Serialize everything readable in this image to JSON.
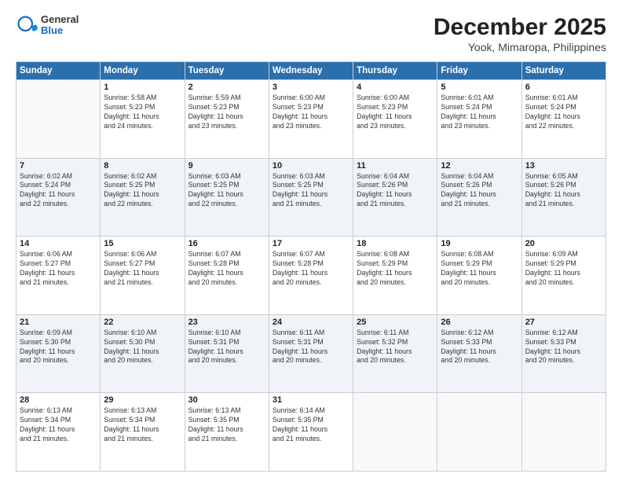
{
  "header": {
    "logo_general": "General",
    "logo_blue": "Blue",
    "month_title": "December 2025",
    "location": "Yook, Mimaropa, Philippines"
  },
  "days_of_week": [
    "Sunday",
    "Monday",
    "Tuesday",
    "Wednesday",
    "Thursday",
    "Friday",
    "Saturday"
  ],
  "weeks": [
    [
      {
        "day": "",
        "info": ""
      },
      {
        "day": "1",
        "info": "Sunrise: 5:58 AM\nSunset: 5:23 PM\nDaylight: 11 hours\nand 24 minutes."
      },
      {
        "day": "2",
        "info": "Sunrise: 5:59 AM\nSunset: 5:23 PM\nDaylight: 11 hours\nand 23 minutes."
      },
      {
        "day": "3",
        "info": "Sunrise: 6:00 AM\nSunset: 5:23 PM\nDaylight: 11 hours\nand 23 minutes."
      },
      {
        "day": "4",
        "info": "Sunrise: 6:00 AM\nSunset: 5:23 PM\nDaylight: 11 hours\nand 23 minutes."
      },
      {
        "day": "5",
        "info": "Sunrise: 6:01 AM\nSunset: 5:24 PM\nDaylight: 11 hours\nand 23 minutes."
      },
      {
        "day": "6",
        "info": "Sunrise: 6:01 AM\nSunset: 5:24 PM\nDaylight: 11 hours\nand 22 minutes."
      }
    ],
    [
      {
        "day": "7",
        "info": "Sunrise: 6:02 AM\nSunset: 5:24 PM\nDaylight: 11 hours\nand 22 minutes."
      },
      {
        "day": "8",
        "info": "Sunrise: 6:02 AM\nSunset: 5:25 PM\nDaylight: 11 hours\nand 22 minutes."
      },
      {
        "day": "9",
        "info": "Sunrise: 6:03 AM\nSunset: 5:25 PM\nDaylight: 11 hours\nand 22 minutes."
      },
      {
        "day": "10",
        "info": "Sunrise: 6:03 AM\nSunset: 5:25 PM\nDaylight: 11 hours\nand 21 minutes."
      },
      {
        "day": "11",
        "info": "Sunrise: 6:04 AM\nSunset: 5:26 PM\nDaylight: 11 hours\nand 21 minutes."
      },
      {
        "day": "12",
        "info": "Sunrise: 6:04 AM\nSunset: 5:26 PM\nDaylight: 11 hours\nand 21 minutes."
      },
      {
        "day": "13",
        "info": "Sunrise: 6:05 AM\nSunset: 5:26 PM\nDaylight: 11 hours\nand 21 minutes."
      }
    ],
    [
      {
        "day": "14",
        "info": "Sunrise: 6:06 AM\nSunset: 5:27 PM\nDaylight: 11 hours\nand 21 minutes."
      },
      {
        "day": "15",
        "info": "Sunrise: 6:06 AM\nSunset: 5:27 PM\nDaylight: 11 hours\nand 21 minutes."
      },
      {
        "day": "16",
        "info": "Sunrise: 6:07 AM\nSunset: 5:28 PM\nDaylight: 11 hours\nand 20 minutes."
      },
      {
        "day": "17",
        "info": "Sunrise: 6:07 AM\nSunset: 5:28 PM\nDaylight: 11 hours\nand 20 minutes."
      },
      {
        "day": "18",
        "info": "Sunrise: 6:08 AM\nSunset: 5:29 PM\nDaylight: 11 hours\nand 20 minutes."
      },
      {
        "day": "19",
        "info": "Sunrise: 6:08 AM\nSunset: 5:29 PM\nDaylight: 11 hours\nand 20 minutes."
      },
      {
        "day": "20",
        "info": "Sunrise: 6:09 AM\nSunset: 5:29 PM\nDaylight: 11 hours\nand 20 minutes."
      }
    ],
    [
      {
        "day": "21",
        "info": "Sunrise: 6:09 AM\nSunset: 5:30 PM\nDaylight: 11 hours\nand 20 minutes."
      },
      {
        "day": "22",
        "info": "Sunrise: 6:10 AM\nSunset: 5:30 PM\nDaylight: 11 hours\nand 20 minutes."
      },
      {
        "day": "23",
        "info": "Sunrise: 6:10 AM\nSunset: 5:31 PM\nDaylight: 11 hours\nand 20 minutes."
      },
      {
        "day": "24",
        "info": "Sunrise: 6:11 AM\nSunset: 5:31 PM\nDaylight: 11 hours\nand 20 minutes."
      },
      {
        "day": "25",
        "info": "Sunrise: 6:11 AM\nSunset: 5:32 PM\nDaylight: 11 hours\nand 20 minutes."
      },
      {
        "day": "26",
        "info": "Sunrise: 6:12 AM\nSunset: 5:33 PM\nDaylight: 11 hours\nand 20 minutes."
      },
      {
        "day": "27",
        "info": "Sunrise: 6:12 AM\nSunset: 5:33 PM\nDaylight: 11 hours\nand 20 minutes."
      }
    ],
    [
      {
        "day": "28",
        "info": "Sunrise: 6:13 AM\nSunset: 5:34 PM\nDaylight: 11 hours\nand 21 minutes."
      },
      {
        "day": "29",
        "info": "Sunrise: 6:13 AM\nSunset: 5:34 PM\nDaylight: 11 hours\nand 21 minutes."
      },
      {
        "day": "30",
        "info": "Sunrise: 6:13 AM\nSunset: 5:35 PM\nDaylight: 11 hours\nand 21 minutes."
      },
      {
        "day": "31",
        "info": "Sunrise: 6:14 AM\nSunset: 5:35 PM\nDaylight: 11 hours\nand 21 minutes."
      },
      {
        "day": "",
        "info": ""
      },
      {
        "day": "",
        "info": ""
      },
      {
        "day": "",
        "info": ""
      }
    ]
  ]
}
